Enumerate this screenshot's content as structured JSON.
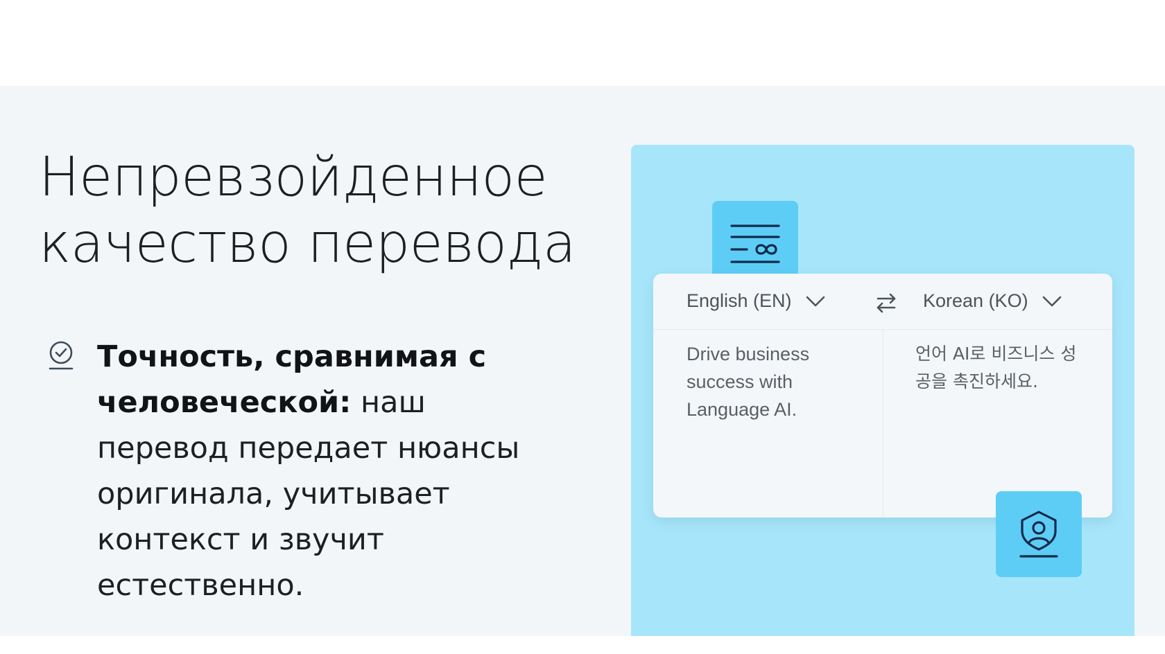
{
  "heading": {
    "line1": "Непревзойденное",
    "line2": "качество перевода"
  },
  "feature": {
    "icon": "check-badge-icon",
    "title": "Точность, сравнимая с человеческой:",
    "body": " наш перевод передает нюансы оригинала, учитывает контекст и звучит естественно."
  },
  "translator": {
    "source_lang": "English (EN)",
    "target_lang": "Korean (KO)",
    "source_text": "Drive business success with Language AI.",
    "target_text": "언어 AI로 비즈니스 성공을 촉진하세요.",
    "icons": {
      "top_badge": "text-infinity-icon",
      "bottom_badge": "shield-user-icon",
      "swap": "swap-arrows-icon",
      "dropdown": "chevron-down-icon"
    }
  },
  "colors": {
    "section_bg": "#f3f6f8",
    "illustration_bg": "#a7e6fa",
    "badge_bg": "#5ecdf6",
    "icon_stroke": "#0f2b4a",
    "text": "#1d1f23"
  }
}
